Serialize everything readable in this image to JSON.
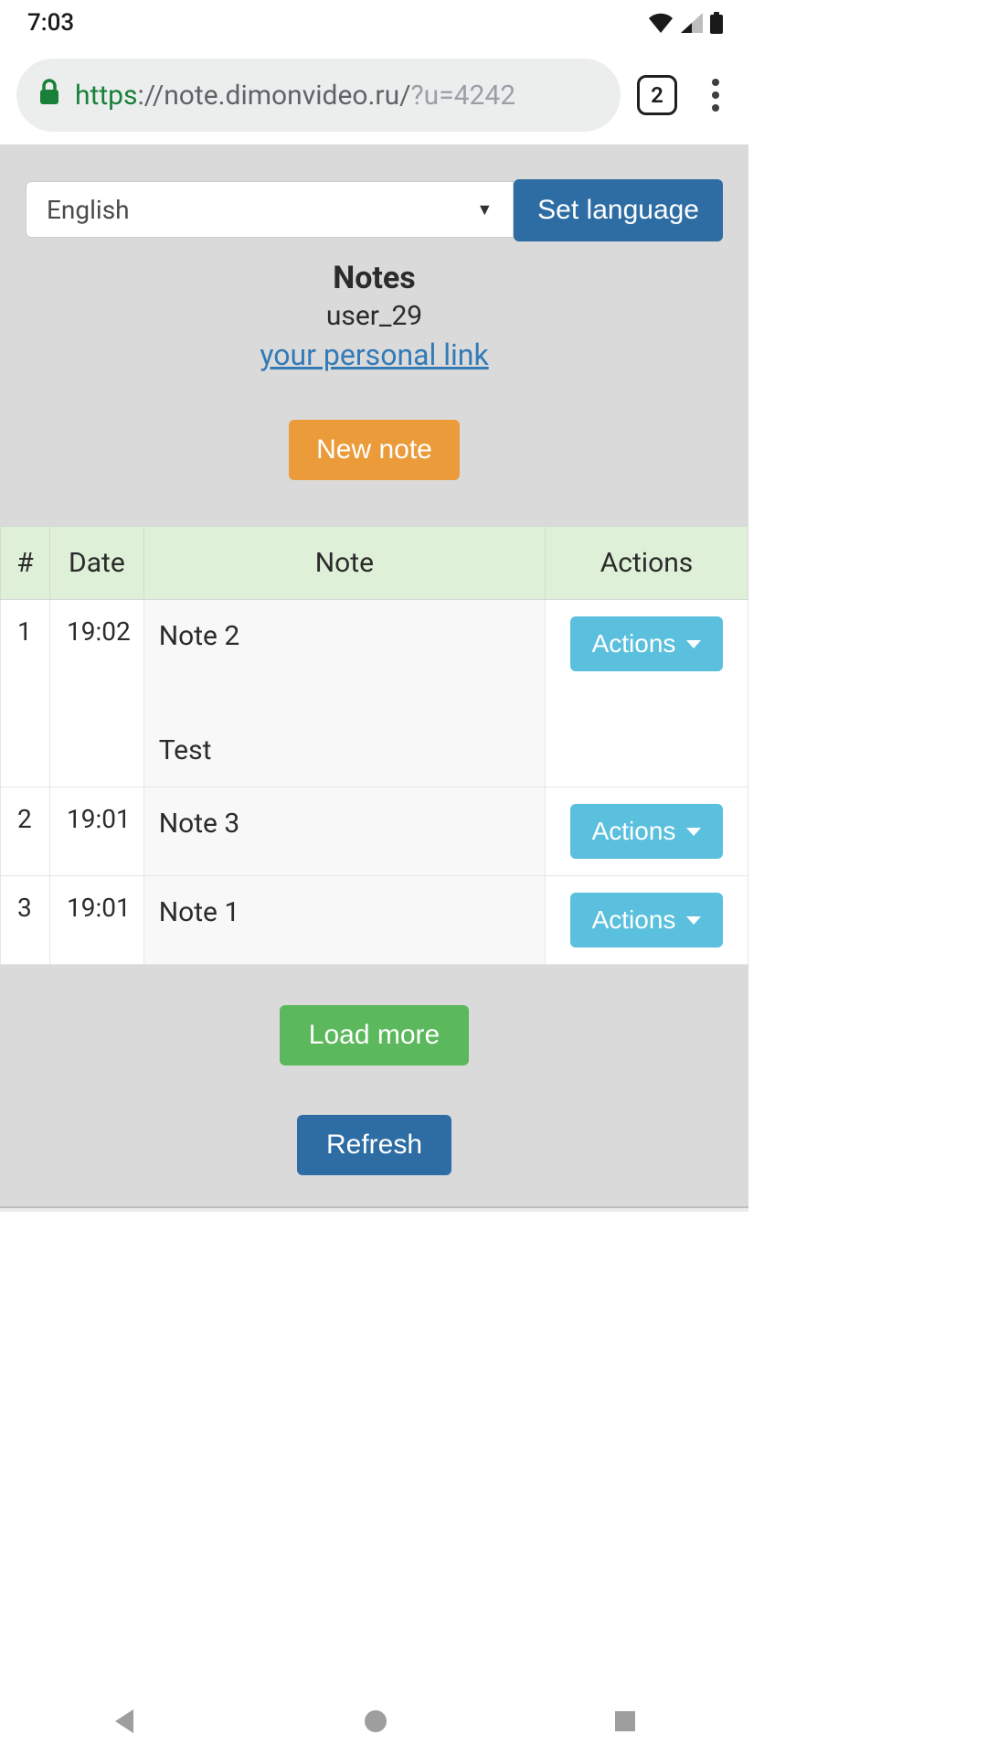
{
  "status": {
    "time": "7:03"
  },
  "chrome": {
    "url_https": "https",
    "url_domain": "://note.dimonvideo.ru/",
    "url_query": "?u=4242",
    "tab_count": "2"
  },
  "lang": {
    "selected": "English",
    "button": "Set language"
  },
  "header": {
    "title": "Notes",
    "user": "user_29",
    "personal_link": "your personal link"
  },
  "buttons": {
    "new_note": "New note",
    "load_more": "Load more",
    "refresh": "Refresh",
    "actions": "Actions"
  },
  "table": {
    "headers": {
      "idx": "#",
      "date": "Date",
      "note": "Note",
      "actions": "Actions"
    },
    "rows": [
      {
        "idx": "1",
        "date": "19:02",
        "title": "Note 2",
        "body": "Test"
      },
      {
        "idx": "2",
        "date": "19:01",
        "title": "Note 3",
        "body": ""
      },
      {
        "idx": "3",
        "date": "19:01",
        "title": "Note 1",
        "body": ""
      }
    ]
  }
}
